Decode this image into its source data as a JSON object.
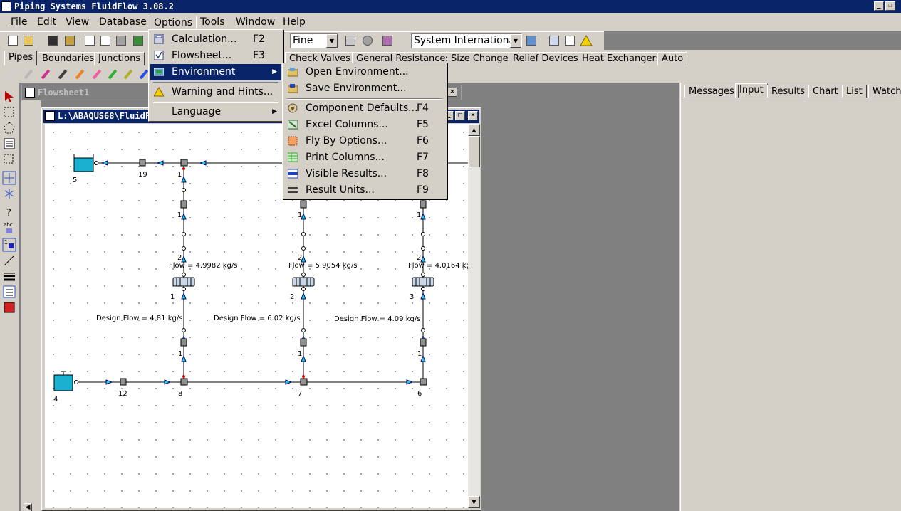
{
  "app": {
    "title": "Piping Systems FluidFlow 3.08.2",
    "window_buttons": [
      "_",
      "❐",
      "×"
    ]
  },
  "menubar": {
    "items": [
      "File",
      "Edit",
      "View",
      "Database",
      "Options",
      "Tools",
      "Window",
      "Help"
    ]
  },
  "toolbar": {
    "mesh_value": "Fine",
    "units_value": "System International"
  },
  "component_tabs": [
    "Pipes",
    "Boundaries",
    "Junctions",
    "Check Valves",
    "General Resistances",
    "Size Change",
    "Relief Devices",
    "Heat Exchangers",
    "Auto"
  ],
  "right_panel": {
    "tabs": [
      "Messages",
      "Input",
      "Results",
      "Chart",
      "List",
      "Watch"
    ],
    "active_tab": "Input"
  },
  "windows": {
    "flowsheet1_title": "Flowsheet1",
    "flowsheet2_title": "L:\\ABAQUS68\\FluidF"
  },
  "options_menu": {
    "items": [
      {
        "label": "Calculation...",
        "shortcut": "F2",
        "icon": "calculator-icon"
      },
      {
        "label": "Flowsheet...",
        "shortcut": "F3",
        "icon": "checkbox-icon"
      },
      {
        "label": "Environment",
        "shortcut": "",
        "icon": "environment-icon",
        "submenu": true
      },
      {
        "label": "Warning and Hints...",
        "shortcut": "",
        "icon": "warning-icon"
      },
      {
        "label": "Language",
        "shortcut": "",
        "icon": "",
        "submenu": true
      }
    ]
  },
  "environment_menu": {
    "items": [
      {
        "label": "Open Environment...",
        "shortcut": "",
        "icon": "open-environment-icon"
      },
      {
        "label": "Save Environment...",
        "shortcut": "",
        "icon": "save-environment-icon"
      },
      {
        "label": "Component Defaults...",
        "shortcut": "F4",
        "icon": "component-defaults-icon"
      },
      {
        "label": "Excel Columns...",
        "shortcut": "F5",
        "icon": "excel-icon"
      },
      {
        "label": "Fly By Options...",
        "shortcut": "F6",
        "icon": "fly-by-icon"
      },
      {
        "label": "Print Columns...",
        "shortcut": "F7",
        "icon": "print-columns-icon"
      },
      {
        "label": "Visible Results...",
        "shortcut": "F8",
        "icon": "visible-results-icon"
      },
      {
        "label": "Result Units...",
        "shortcut": "F9",
        "icon": "result-units-icon"
      }
    ]
  },
  "flowsheet": {
    "flow_labels": [
      "Flow = 4.9982 kg/s",
      "Flow = 5.9054 kg/s",
      "Flow = 4.0164 kg"
    ],
    "design_flow_labels": [
      "Design Flow = 4.81 kg/s",
      "Design Flow = 6.02 kg/s",
      "Design Flow = 4.09 kg/s"
    ],
    "node_labels": [
      "5",
      "19",
      "1",
      "1",
      "2",
      "1",
      "1",
      "2",
      "2",
      "1",
      "1",
      "1",
      "2",
      "3",
      "4",
      "12",
      "8",
      "7",
      "6"
    ]
  },
  "colors": {
    "title_bar": "#0a246a",
    "menu_highlight": "#0a246a",
    "workspace": "#808080",
    "panel": "#d4d0c8",
    "node_accent": "#00b0c8"
  }
}
